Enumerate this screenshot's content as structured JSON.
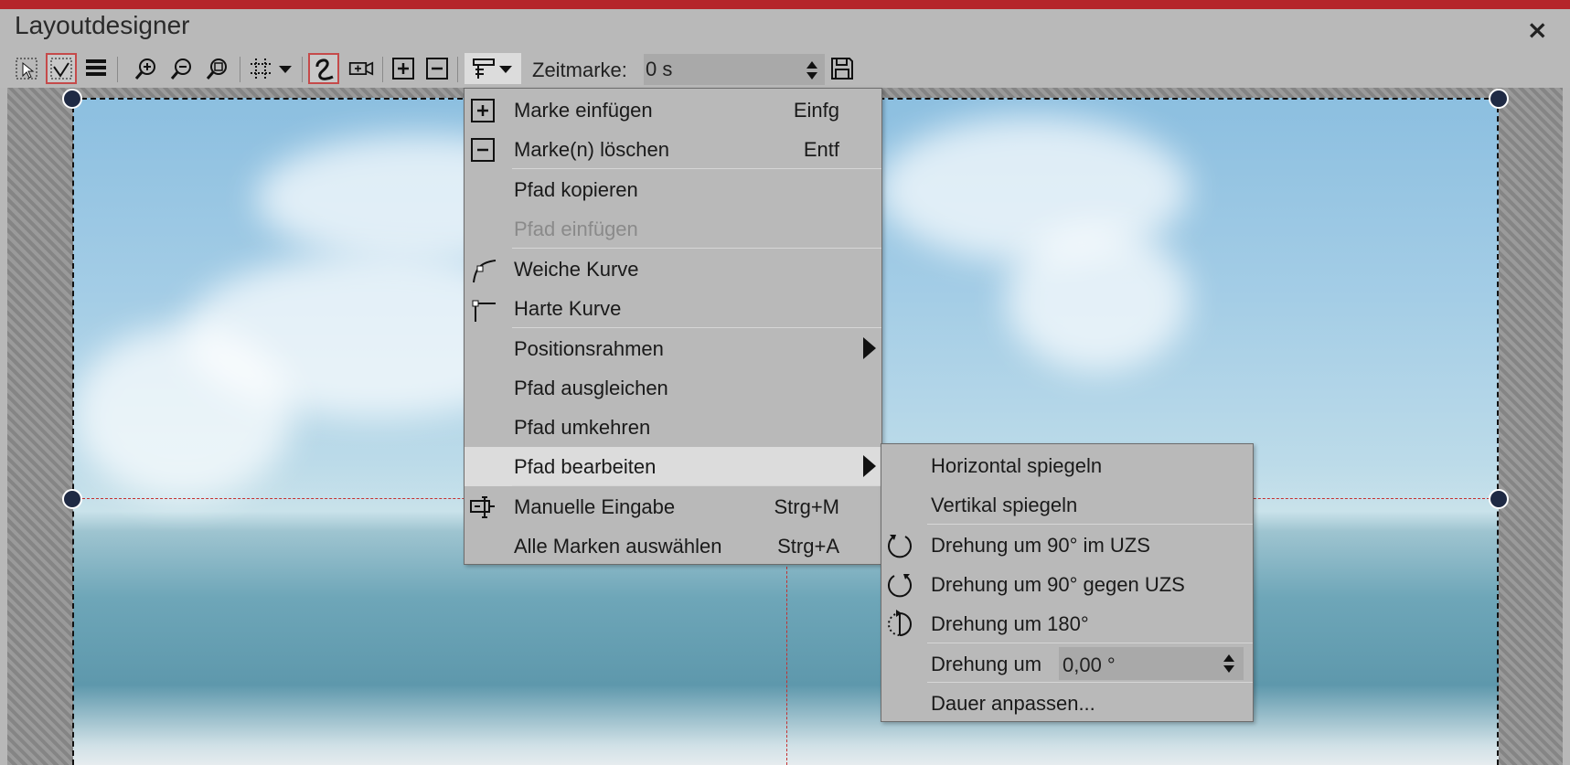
{
  "window": {
    "title": "Layoutdesigner",
    "close_glyph": "×"
  },
  "toolbar": {
    "zeitmarke_label": "Zeitmarke:",
    "zeitmarke_value": "0 s",
    "icons": [
      "select-icon",
      "path-select-icon",
      "layers-icon",
      "zoom-in-icon",
      "zoom-out-icon",
      "zoom-fit-icon",
      "grid-icon",
      "dropdown-arrow-icon",
      "path-icon",
      "camera-icon",
      "add-mark-icon",
      "remove-mark-icon",
      "path-menu-icon",
      "dropdown-arrow-icon",
      "save-icon"
    ]
  },
  "context_menu": {
    "items": [
      {
        "label": "Marke einfügen",
        "shortcut": "Einfg",
        "icon": "plus-box-icon",
        "enabled": true
      },
      {
        "label": "Marke(n) löschen",
        "shortcut": "Entf",
        "icon": "minus-box-icon",
        "enabled": true
      },
      {
        "label": "Pfad kopieren",
        "shortcut": "",
        "icon": "",
        "enabled": true
      },
      {
        "label": "Pfad einfügen",
        "shortcut": "",
        "icon": "",
        "enabled": false
      },
      {
        "label": "Weiche Kurve",
        "shortcut": "",
        "icon": "smooth-curve-icon",
        "enabled": true
      },
      {
        "label": "Harte Kurve",
        "shortcut": "",
        "icon": "hard-curve-icon",
        "enabled": true
      },
      {
        "label": "Positionsrahmen",
        "shortcut": "",
        "icon": "",
        "enabled": true,
        "submenu": true
      },
      {
        "label": "Pfad ausgleichen",
        "shortcut": "",
        "icon": "",
        "enabled": true
      },
      {
        "label": "Pfad umkehren",
        "shortcut": "",
        "icon": "",
        "enabled": true
      },
      {
        "label": "Pfad bearbeiten",
        "shortcut": "",
        "icon": "",
        "enabled": true,
        "submenu": true,
        "highlighted": true
      },
      {
        "label": "Manuelle Eingabe",
        "shortcut": "Strg+M",
        "icon": "manual-input-icon",
        "enabled": true
      },
      {
        "label": "Alle Marken auswählen",
        "shortcut": "Strg+A",
        "icon": "",
        "enabled": true
      }
    ]
  },
  "submenu": {
    "items": [
      {
        "label": "Horizontal spiegeln",
        "icon": ""
      },
      {
        "label": "Vertikal spiegeln",
        "icon": ""
      },
      {
        "label": "Drehung um 90° im UZS",
        "icon": "rotate-cw-icon"
      },
      {
        "label": "Drehung um 90° gegen UZS",
        "icon": "rotate-ccw-icon"
      },
      {
        "label": "Drehung um 180°",
        "icon": "rotate-180-icon"
      },
      {
        "label": "Drehung um",
        "icon": ""
      },
      {
        "label": "Dauer anpassen...",
        "icon": ""
      }
    ],
    "rotation_value": "0,00 °"
  }
}
